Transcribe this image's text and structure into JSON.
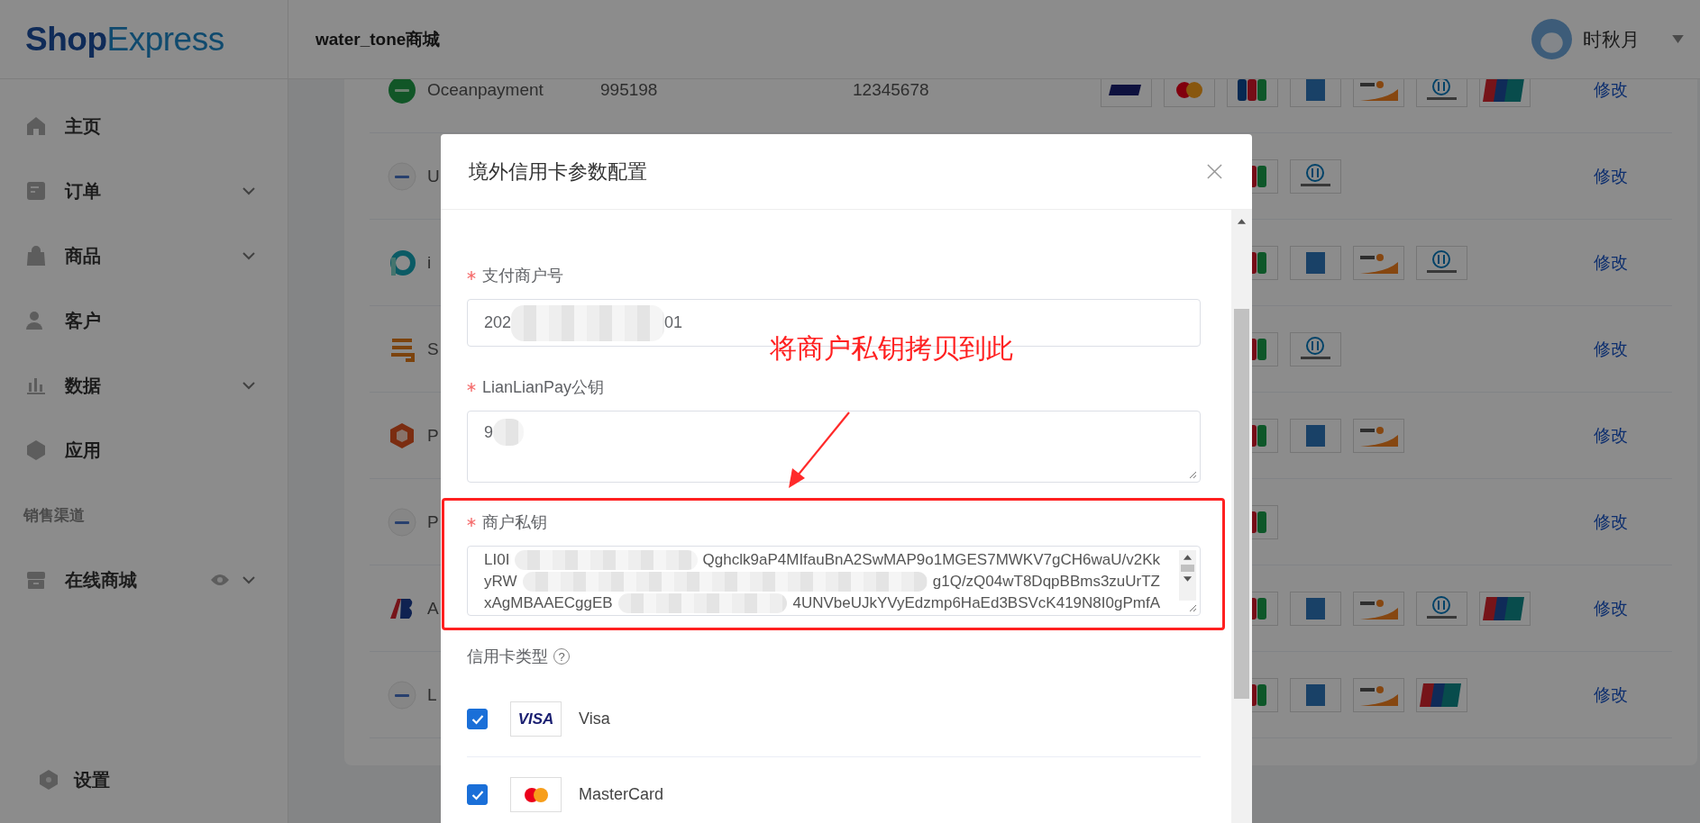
{
  "header": {
    "logo": {
      "part_1": "Shop",
      "part_2": "Express"
    },
    "store_name": "water_tone商城",
    "user": {
      "name": "时秋月"
    }
  },
  "sidebar": {
    "items": [
      {
        "label": "主页",
        "kind": "link"
      },
      {
        "label": "订单",
        "kind": "group"
      },
      {
        "label": "商品",
        "kind": "group"
      },
      {
        "label": "客户",
        "kind": "link"
      },
      {
        "label": "数据",
        "kind": "group"
      },
      {
        "label": "应用",
        "kind": "link"
      }
    ],
    "section": {
      "title": "销售渠道",
      "items": [
        {
          "label": "在线商城",
          "kind": "channel"
        }
      ]
    },
    "footer_item": {
      "label": "设置"
    }
  },
  "table": {
    "rows": [
      {
        "logo": {
          "kind": "green-disc"
        },
        "name": "Oceanpayment",
        "column_2": "995198",
        "column_3": "12345678",
        "cards": [
          {
            "kind": "visa"
          },
          {
            "kind": "mastercard"
          },
          {
            "kind": "jcb"
          },
          {
            "kind": "amex"
          },
          {
            "kind": "discover"
          },
          {
            "kind": "diners"
          },
          {
            "kind": "unionpay"
          }
        ],
        "action": "修改"
      },
      {
        "logo": {
          "kind": "pale-disc"
        },
        "name": "U",
        "cards": [
          {
            "kind": "jcb"
          },
          {
            "kind": "diners"
          }
        ],
        "action": "修改"
      },
      {
        "logo": {
          "kind": "teal-ring"
        },
        "name": "i",
        "cards": [
          {
            "kind": "jcb"
          },
          {
            "kind": "amex"
          },
          {
            "kind": "discover"
          },
          {
            "kind": "diners"
          }
        ],
        "action": "修改"
      },
      {
        "logo": {
          "kind": "orange-stripes"
        },
        "name": "S",
        "cards": [
          {
            "kind": "jcb"
          },
          {
            "kind": "diners"
          }
        ],
        "action": "修改"
      },
      {
        "logo": {
          "kind": "red-hexagon"
        },
        "name": "P",
        "cards": [
          {
            "kind": "jcb"
          },
          {
            "kind": "amex"
          },
          {
            "kind": "discover"
          }
        ],
        "action": "修改"
      },
      {
        "logo": {
          "kind": "pale-disc"
        },
        "name": "P",
        "cards": [
          {
            "kind": "jcb"
          }
        ],
        "action": "修改"
      },
      {
        "logo": {
          "kind": "blue-red-mark"
        },
        "name": "A",
        "cards": [
          {
            "kind": "jcb"
          },
          {
            "kind": "amex"
          },
          {
            "kind": "discover"
          },
          {
            "kind": "diners"
          },
          {
            "kind": "unionpay"
          }
        ],
        "action": "修改"
      },
      {
        "logo": {
          "kind": "pale-disc"
        },
        "name": "L",
        "cards": [
          {
            "kind": "jcb"
          },
          {
            "kind": "amex"
          },
          {
            "kind": "discover"
          },
          {
            "kind": "unionpay"
          }
        ],
        "action": "修改"
      }
    ]
  },
  "dialog": {
    "title": "境外信用卡参数配置",
    "fields": [
      {
        "label": "支付商户号",
        "required": true,
        "kind": "input",
        "highlighted": false,
        "value_parts": [
          "202",
          "01"
        ]
      },
      {
        "label": "LianLianPay公钥",
        "required": true,
        "kind": "textarea",
        "highlighted": false,
        "value_parts": [
          "9"
        ]
      },
      {
        "label": "商户私钥",
        "required": true,
        "kind": "key-textarea",
        "highlighted": true,
        "lines": [
          [
            "LI0I",
            "Qghclk9aP4MIfauBnA2SwMAP9o1MGES7MWKV7gCH6waU/v2Kk"
          ],
          [
            "yRW",
            "g1Q/zQ04wT8DqpBBms3zuUrTZ"
          ],
          [
            "xAgMBAAECggEB",
            "4UNVbeUJkYVyEdzmp6HaEd3BSVcK419N8I0gPmfA"
          ]
        ]
      }
    ],
    "card_types": {
      "label": "信用卡类型",
      "help_icon": "?",
      "items": [
        {
          "label": "Visa",
          "checked": true,
          "logo": {
            "kind": "visa",
            "mark": "VISA"
          }
        },
        {
          "label": "MasterCard",
          "checked": true,
          "logo": {
            "kind": "mastercard"
          }
        }
      ]
    }
  },
  "annotation": {
    "text": "将商户私钥拷贝到此"
  }
}
